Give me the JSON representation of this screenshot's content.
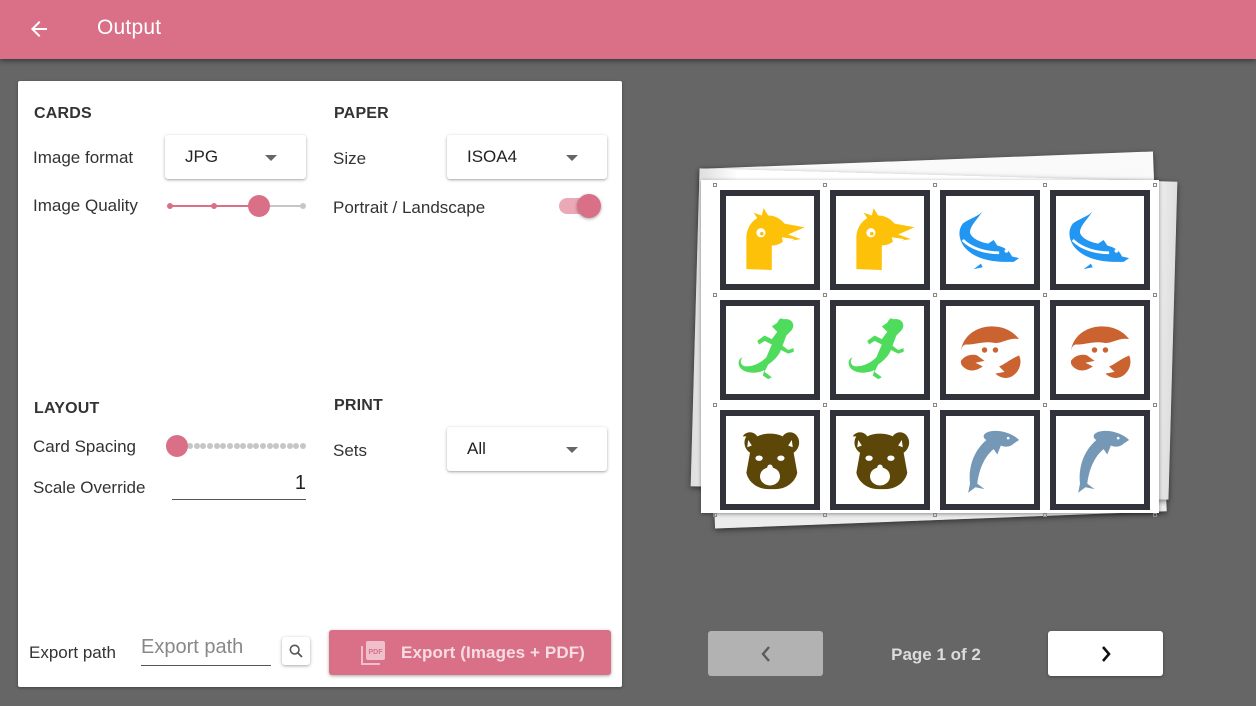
{
  "appbar": {
    "title": "Output",
    "back_icon": "arrow-left-icon",
    "color": "#d97087"
  },
  "cards": {
    "section_title": "CARDS",
    "image_format": {
      "label": "Image format",
      "value": "JPG"
    },
    "image_quality": {
      "label": "Image Quality",
      "steps": 4,
      "value_index": 2
    }
  },
  "paper": {
    "section_title": "PAPER",
    "size": {
      "label": "Size",
      "value": "ISOA4"
    },
    "orientation": {
      "label": "Portrait / Landscape",
      "on": true
    }
  },
  "layout": {
    "section_title": "LAYOUT",
    "card_spacing": {
      "label": "Card Spacing",
      "steps": 21,
      "value_index": 1
    },
    "scale_override": {
      "label": "Scale Override",
      "value": "1"
    }
  },
  "print": {
    "section_title": "PRINT",
    "sets": {
      "label": "Sets",
      "value": "All"
    }
  },
  "export": {
    "path_label": "Export path",
    "path_value": "",
    "path_placeholder": "Export path",
    "browse_icon": "search-icon",
    "button_icon": "pdf-icon",
    "button_label": "Export (Images + PDF)"
  },
  "preview": {
    "cards": [
      {
        "icon": "bird-icon",
        "color": "#fdc10a"
      },
      {
        "icon": "bird-icon",
        "color": "#fdc10a"
      },
      {
        "icon": "fish-icon",
        "color": "#2196f3"
      },
      {
        "icon": "fish-icon",
        "color": "#2196f3"
      },
      {
        "icon": "gecko-icon",
        "color": "#4fdc5c"
      },
      {
        "icon": "gecko-icon",
        "color": "#4fdc5c"
      },
      {
        "icon": "crab-icon",
        "color": "#cb6331"
      },
      {
        "icon": "crab-icon",
        "color": "#cb6331"
      },
      {
        "icon": "bear-icon",
        "color": "#5d4708"
      },
      {
        "icon": "bear-icon",
        "color": "#5d4708"
      },
      {
        "icon": "dolphin-icon",
        "color": "#7498b6"
      },
      {
        "icon": "dolphin-icon",
        "color": "#7498b6"
      }
    ],
    "columns": 4
  },
  "pager": {
    "label": "Page 1 of 2",
    "current": 1,
    "total": 2,
    "prev_icon": "chevron-left-icon",
    "next_icon": "chevron-right-icon"
  }
}
